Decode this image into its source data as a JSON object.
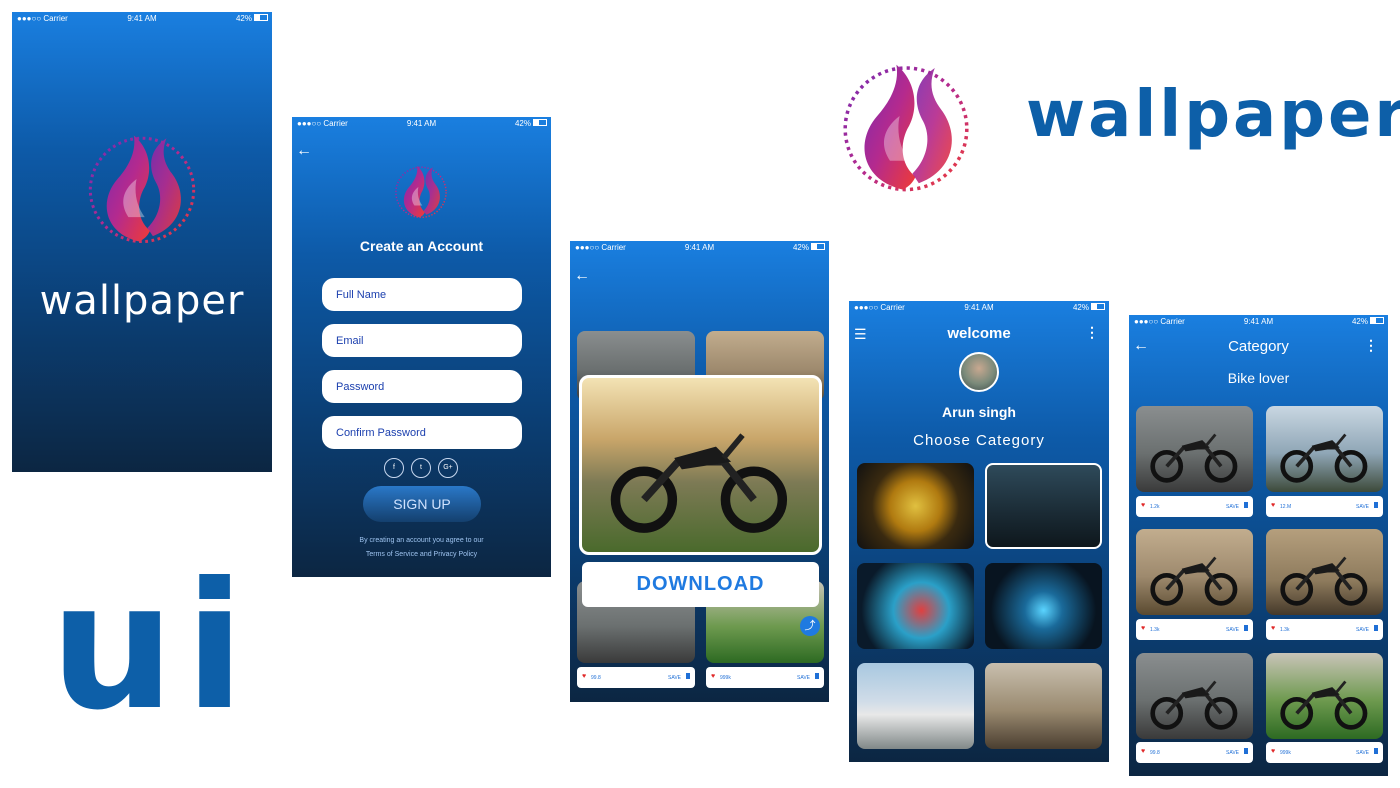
{
  "status": {
    "carrier": "●●●○○ Carrier",
    "time": "9:41 AM",
    "battery": "42%"
  },
  "brand": {
    "name": "wallpaper",
    "ui_label": "ui",
    "accent": "#0d5fa8"
  },
  "signup_screen": {
    "title": "Create an Account",
    "fields": [
      {
        "placeholder": "Full Name"
      },
      {
        "placeholder": "Email"
      },
      {
        "placeholder": "Password"
      },
      {
        "placeholder": "Confirm Password"
      }
    ],
    "social": [
      "f",
      "t",
      "G+"
    ],
    "button": "SIGN UP",
    "terms_line1": "By creating an account you agree to our",
    "terms_line2": "Terms of Service and Privacy Policy"
  },
  "preview_screen": {
    "download_label": "DOWNLOAD",
    "tiles": [
      {
        "count": "99.8",
        "save": "SAVE"
      },
      {
        "count": "999k",
        "save": "SAVE"
      }
    ]
  },
  "home_screen": {
    "title": "welcome",
    "user_name": "Arun singh",
    "subtitle": "Choose Category"
  },
  "category_screen": {
    "title": "Category",
    "subtitle": "Bike lover",
    "tiles": [
      {
        "count": "1.2k",
        "save": "SAVE"
      },
      {
        "count": "12.M",
        "save": "SAVE"
      },
      {
        "count": "1.3k",
        "save": "SAVE"
      },
      {
        "count": "1.3k",
        "save": "SAVE"
      },
      {
        "count": "99.8",
        "save": "SAVE"
      },
      {
        "count": "999k",
        "save": "SAVE"
      }
    ]
  }
}
